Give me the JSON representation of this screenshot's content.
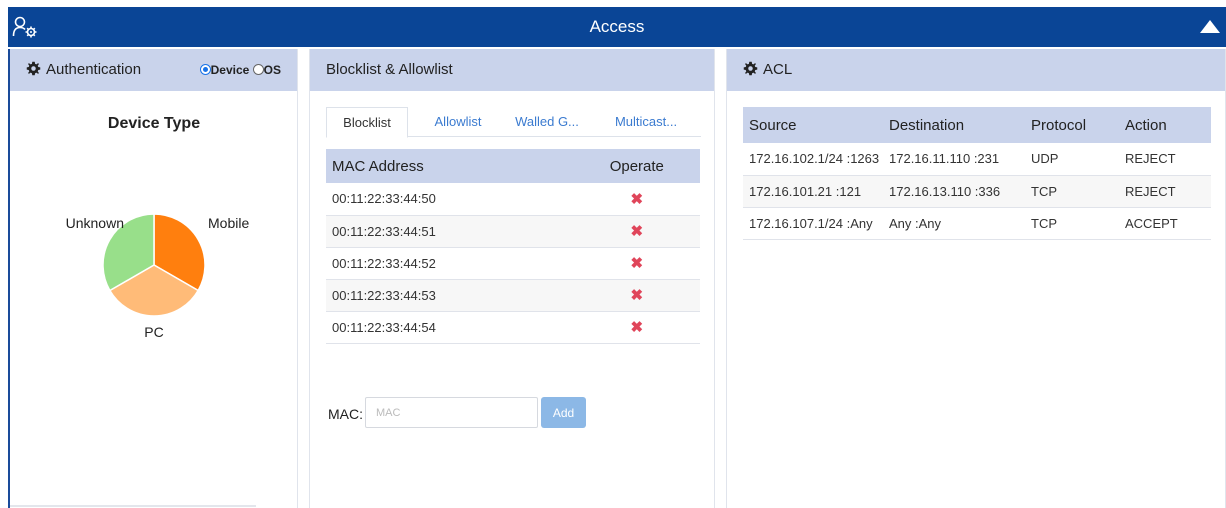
{
  "header": {
    "title": "Access"
  },
  "authentication": {
    "title": "Authentication",
    "options": [
      "Device",
      "OS"
    ],
    "selected": "Device",
    "chart_title": "Device Type"
  },
  "chart_data": {
    "type": "pie",
    "title": "Device Type",
    "slices": [
      {
        "label": "Mobile",
        "value": 33.3,
        "color": "#ff7f0e"
      },
      {
        "label": "PC",
        "value": 33.3,
        "color": "#ffbb78"
      },
      {
        "label": "Unknown",
        "value": 33.3,
        "color": "#98df8a"
      }
    ]
  },
  "blocklist": {
    "title": "Blocklist & Allowlist",
    "tabs": [
      "Blocklist",
      "Allowlist",
      "Walled G...",
      "Multicast..."
    ],
    "active_tab": "Blocklist",
    "columns": [
      "MAC Address",
      "Operate"
    ],
    "rows": [
      {
        "mac": "00:11:22:33:44:50",
        "operate": "✖"
      },
      {
        "mac": "00:11:22:33:44:51",
        "operate": "✖"
      },
      {
        "mac": "00:11:22:33:44:52",
        "operate": "✖"
      },
      {
        "mac": "00:11:22:33:44:53",
        "operate": "✖"
      },
      {
        "mac": "00:11:22:33:44:54",
        "operate": "✖"
      }
    ],
    "mac_label": "MAC:",
    "mac_placeholder": "MAC",
    "mac_value": "",
    "add_label": "Add"
  },
  "acl": {
    "title": "ACL",
    "columns": [
      "Source",
      "Destination",
      "Protocol",
      "Action"
    ],
    "rows": [
      {
        "source": "172.16.102.1/24 :1263",
        "destination": "172.16.11.110 :231",
        "protocol": "UDP",
        "action": "REJECT"
      },
      {
        "source": "172.16.101.21 :121",
        "destination": "172.16.13.110 :336",
        "protocol": "TCP",
        "action": "REJECT"
      },
      {
        "source": "172.16.107.1/24 :Any",
        "destination": "Any :Any",
        "protocol": "TCP",
        "action": "ACCEPT"
      }
    ]
  },
  "colors": {
    "header_bg": "#0a4596",
    "panel_header_bg": "#c9d3eb",
    "delete_red": "#e0455a",
    "link_blue": "#3b7bd0",
    "add_button": "#8cb8e6"
  }
}
